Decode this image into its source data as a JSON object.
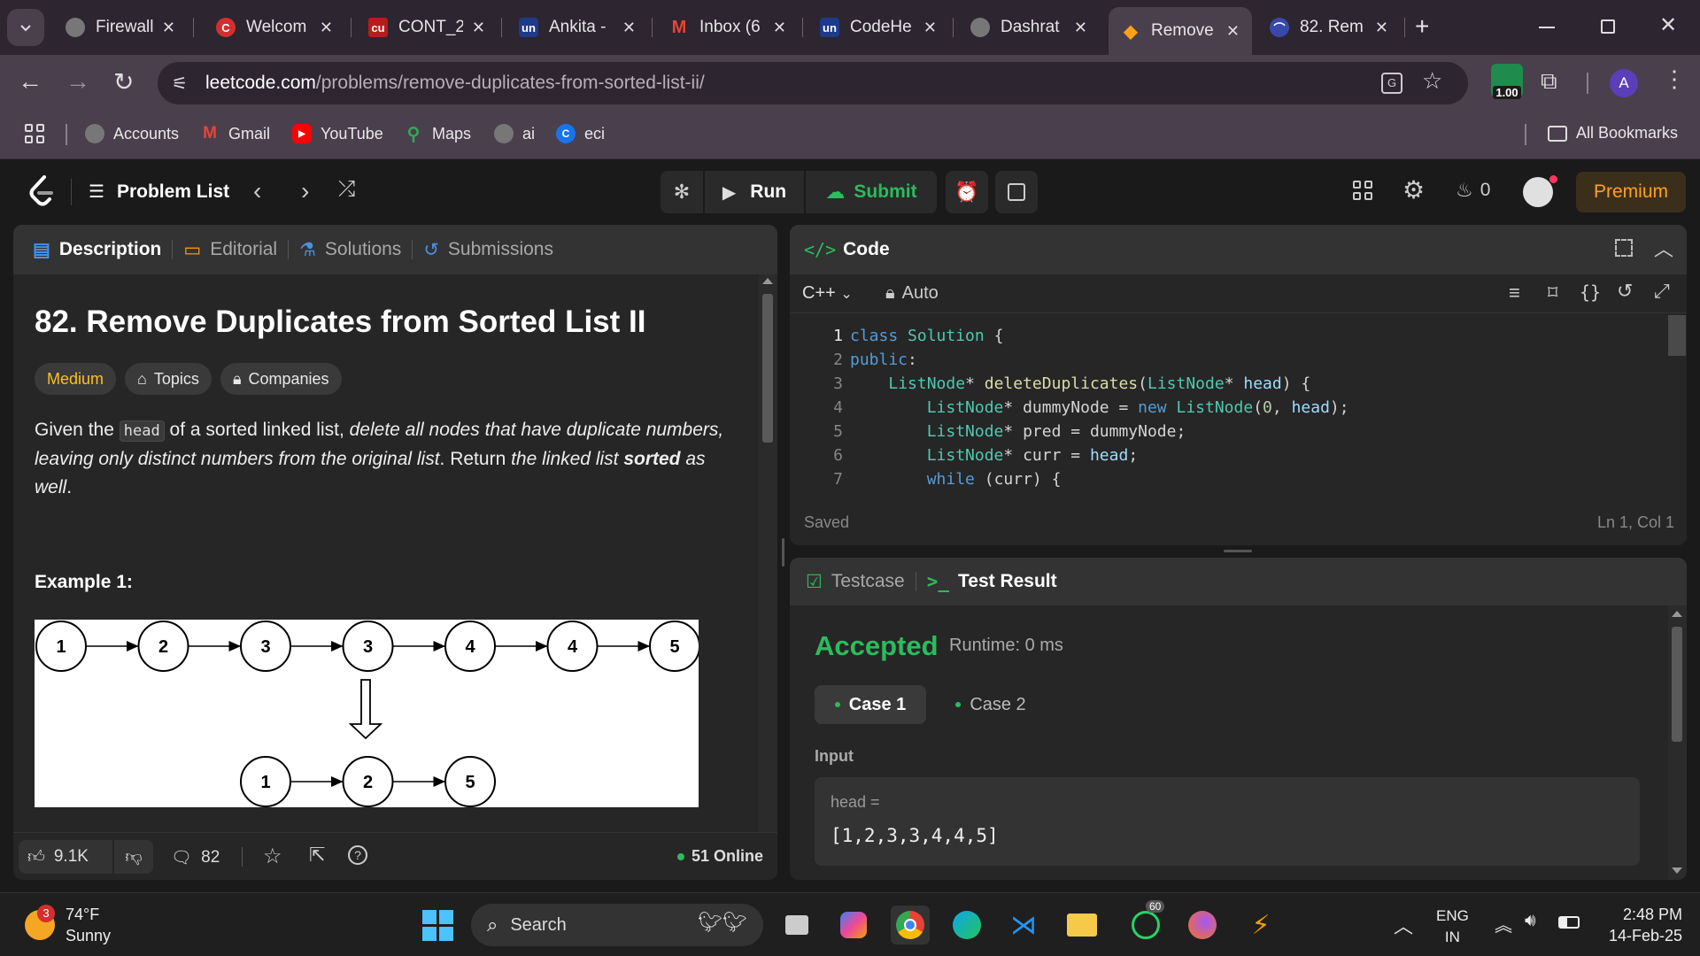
{
  "browser": {
    "tabs": [
      {
        "title": "Firewall",
        "favicon": "globe-icon"
      },
      {
        "title": "Welcom",
        "favicon": "codechef-icon"
      },
      {
        "title": "CONT_2",
        "favicon": "cu-icon"
      },
      {
        "title": "Ankita -",
        "favicon": "unstop-icon"
      },
      {
        "title": "Inbox (6",
        "favicon": "gmail-icon"
      },
      {
        "title": "CodeHe",
        "favicon": "unstop-icon"
      },
      {
        "title": "Dashrat",
        "favicon": "globe-icon"
      },
      {
        "title": "Remove",
        "favicon": "leetcode-icon",
        "active": true
      },
      {
        "title": "82. Rem",
        "favicon": "bookmark-icon"
      }
    ],
    "url_domain": "leetcode.com",
    "url_path": "/problems/remove-duplicates-from-sorted-list-ii/",
    "extension_badge": "1.00",
    "profile_initial": "A",
    "bookmarks": [
      "Accounts",
      "Gmail",
      "YouTube",
      "Maps",
      "ai",
      "eci"
    ],
    "all_bookmarks": "All Bookmarks"
  },
  "header": {
    "problem_list": "Problem List",
    "run": "Run",
    "submit": "Submit",
    "streak": "0",
    "premium": "Premium"
  },
  "left_panel": {
    "tabs": [
      "Description",
      "Editorial",
      "Solutions",
      "Submissions"
    ],
    "title": "82. Remove Duplicates from Sorted List II",
    "difficulty": "Medium",
    "topics": "Topics",
    "companies": "Companies",
    "desc": {
      "p1": "Given the ",
      "code": "head",
      "p2": " of a sorted linked list, ",
      "em1": "delete all nodes that have duplicate numbers, leaving only distinct numbers from the original list",
      "p3": ". Return ",
      "em2": "the linked list ",
      "strong": "sorted",
      "em3": " as well",
      "p4": "."
    },
    "example_title": "Example 1:",
    "diagram": {
      "input_nodes": [
        "1",
        "2",
        "3",
        "3",
        "4",
        "4",
        "5"
      ],
      "output_nodes": [
        "1",
        "2",
        "5"
      ]
    },
    "footer": {
      "likes": "9.1K",
      "comments": "82",
      "online": "51 Online"
    }
  },
  "code_panel": {
    "title": "Code",
    "language": "C++",
    "auto": "Auto",
    "status": "Saved",
    "cursor": "Ln 1, Col 1",
    "lines": [
      "class Solution {",
      "public:",
      "    ListNode* deleteDuplicates(ListNode* head) {",
      "        ListNode* dummyNode = new ListNode(0, head);",
      "        ListNode* pred = dummyNode;",
      "        ListNode* curr = head;",
      "        while (curr) {"
    ]
  },
  "result_panel": {
    "tab_testcase": "Testcase",
    "tab_result": "Test Result",
    "verdict": "Accepted",
    "runtime": "Runtime: 0 ms",
    "cases": [
      "Case 1",
      "Case 2"
    ],
    "input_label": "Input",
    "var_name": "head =",
    "var_value": "[1,2,3,3,4,4,5]"
  },
  "taskbar": {
    "weather_badge": "3",
    "temp": "74°F",
    "condition": "Sunny",
    "search": "Search",
    "whatsapp_badge": "60",
    "lang1": "ENG",
    "lang2": "IN",
    "time": "2:48 PM",
    "date": "14-Feb-25"
  },
  "colors": {
    "accepted": "#2cbb5d",
    "medium": "#ffc01e",
    "premium": "#ffa116",
    "submit": "#2cbb5d"
  }
}
